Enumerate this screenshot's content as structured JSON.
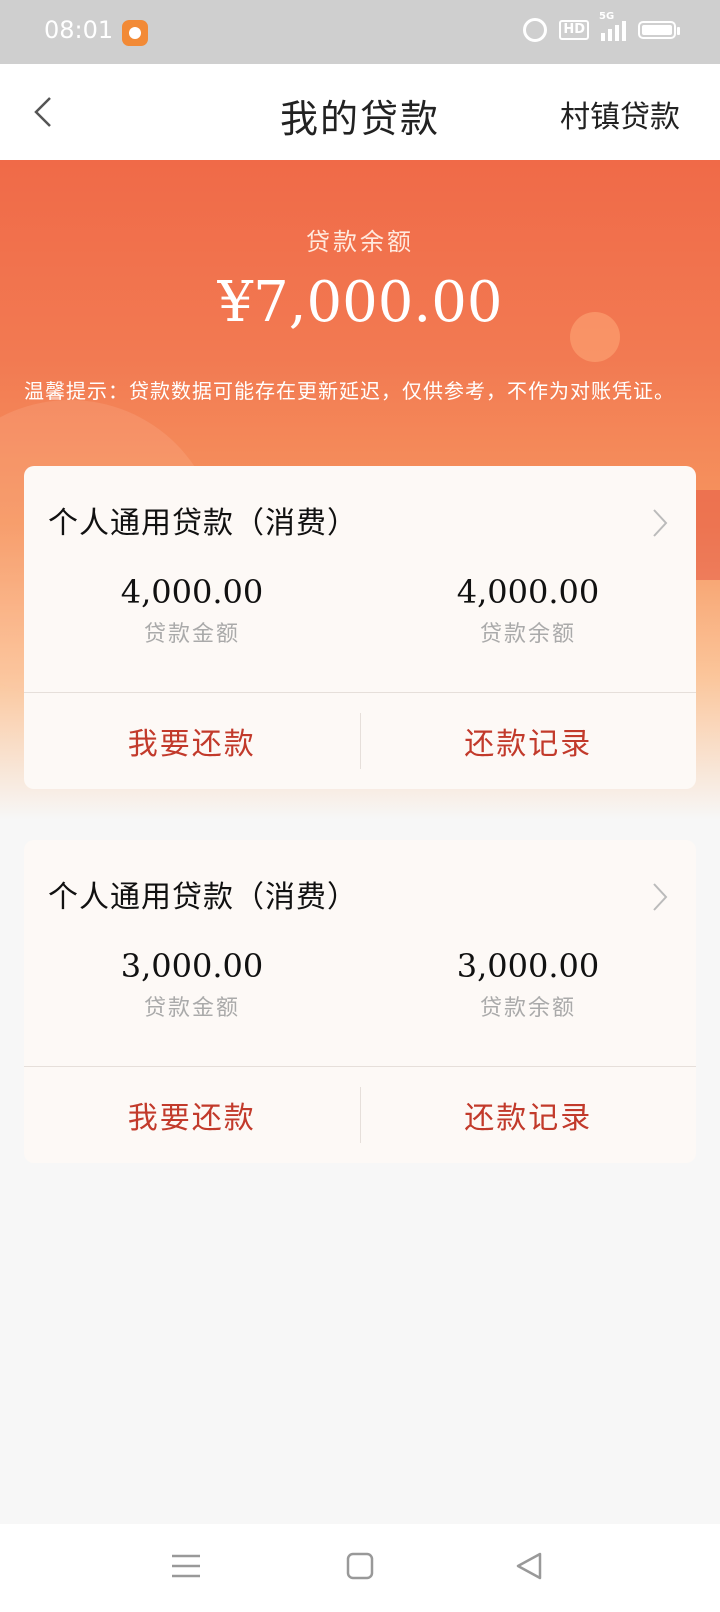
{
  "status_bar": {
    "time": "08:01",
    "network": "5G",
    "hd": "HD"
  },
  "nav": {
    "title": "我的贷款",
    "right_label": "村镇贷款"
  },
  "summary": {
    "label": "贷款余额",
    "amount": "¥7,000.00",
    "notice": "温馨提示：贷款数据可能存在更新延迟，仅供参考，不作为对账凭证。"
  },
  "loans": [
    {
      "title": "个人通用贷款（消费）",
      "amount_value": "4,000.00",
      "amount_label": "贷款金额",
      "balance_value": "4,000.00",
      "balance_label": "贷款余额",
      "repay_label": "我要还款",
      "records_label": "还款记录"
    },
    {
      "title": "个人通用贷款（消费）",
      "amount_value": "3,000.00",
      "amount_label": "贷款金额",
      "balance_value": "3,000.00",
      "balance_label": "贷款余额",
      "repay_label": "我要还款",
      "records_label": "还款记录"
    }
  ],
  "colors": {
    "accent_red": "#c23a2b",
    "hero_top": "#f06a48",
    "hero_mid": "#f6955f"
  },
  "icons": [
    "back-arrow-icon",
    "chevron-right-icon",
    "menu-icon",
    "home-square-icon",
    "back-triangle-icon"
  ]
}
